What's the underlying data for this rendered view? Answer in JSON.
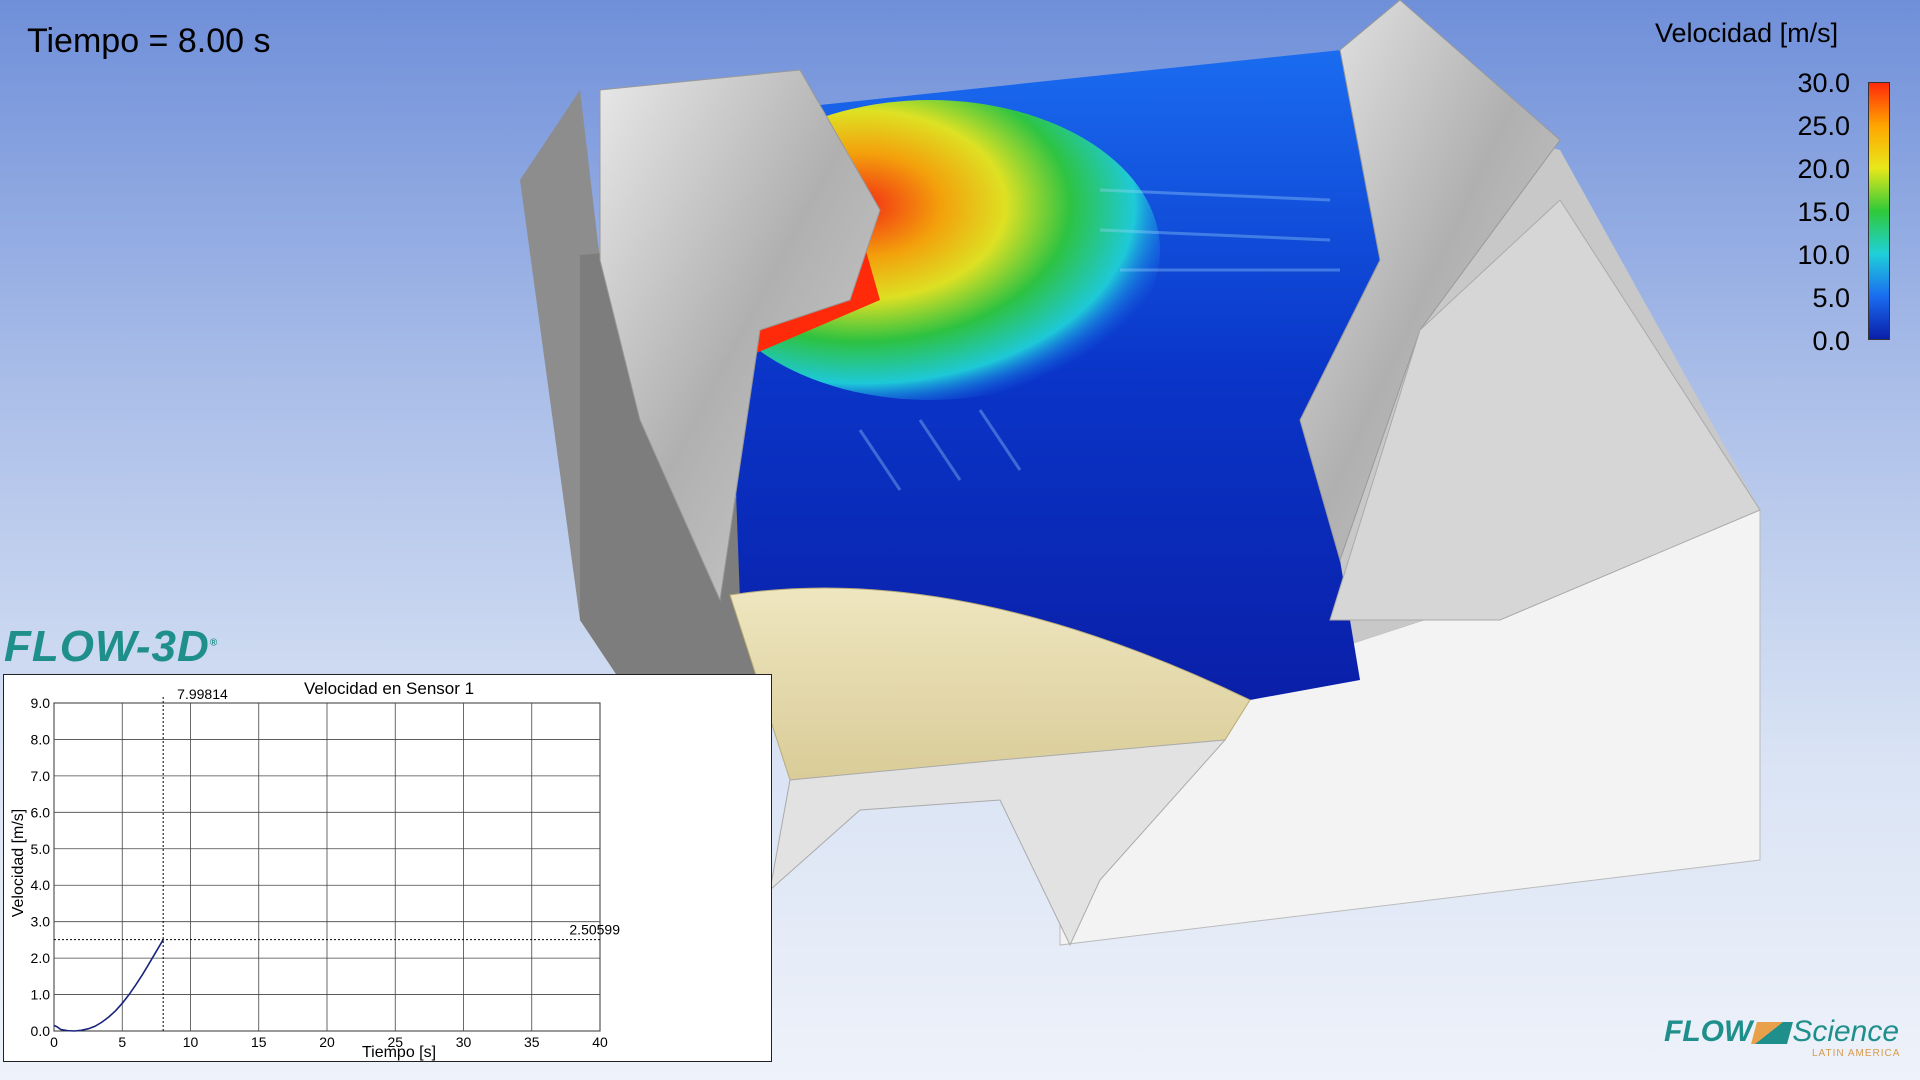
{
  "time_label": "Tiempo = 8.00 s",
  "colorbar": {
    "title": "Velocidad [m/s]",
    "ticks": [
      "30.0",
      "25.0",
      "20.0",
      "15.0",
      "10.0",
      "5.0",
      "0.0"
    ],
    "range": [
      0,
      30
    ],
    "colors": [
      "#ff2a0a",
      "#ffa500",
      "#e8e81a",
      "#2fc93a",
      "#1fd0d8",
      "#1a6cf0",
      "#0a1fa8"
    ]
  },
  "logos": {
    "flow3d": "FLOW-3D",
    "flowscience_a": "FLOW",
    "flowscience_b": "Science",
    "flowscience_sub": "LATIN AMERICA"
  },
  "chart_data": {
    "type": "line",
    "title": "Velocidad en Sensor 1",
    "xlabel": "Tiempo [s]",
    "ylabel": "Velocidad [m/s]",
    "xlim": [
      0,
      40
    ],
    "ylim": [
      0,
      9
    ],
    "xticks": [
      "0",
      "5",
      "10",
      "15",
      "20",
      "25",
      "30",
      "35",
      "40"
    ],
    "yticks": [
      "0.0",
      "1.0",
      "2.0",
      "3.0",
      "4.0",
      "5.0",
      "6.0",
      "7.0",
      "8.0",
      "9.0"
    ],
    "grid": true,
    "cursor": {
      "x_label": "7.99814",
      "y_label": "2.50599",
      "x": 7.99814,
      "y": 2.50599
    },
    "series": [
      {
        "color": "#1a237e",
        "x": [
          0,
          0.2,
          0.5,
          1.0,
          1.5,
          2.0,
          2.5,
          3.0,
          3.5,
          4.0,
          4.5,
          5.0,
          5.5,
          6.0,
          6.5,
          7.0,
          7.5,
          8.0
        ],
        "y": [
          0.15,
          0.12,
          0.04,
          0.01,
          0.0,
          0.02,
          0.06,
          0.13,
          0.24,
          0.38,
          0.55,
          0.76,
          1.0,
          1.27,
          1.56,
          1.87,
          2.19,
          2.506
        ]
      }
    ]
  }
}
